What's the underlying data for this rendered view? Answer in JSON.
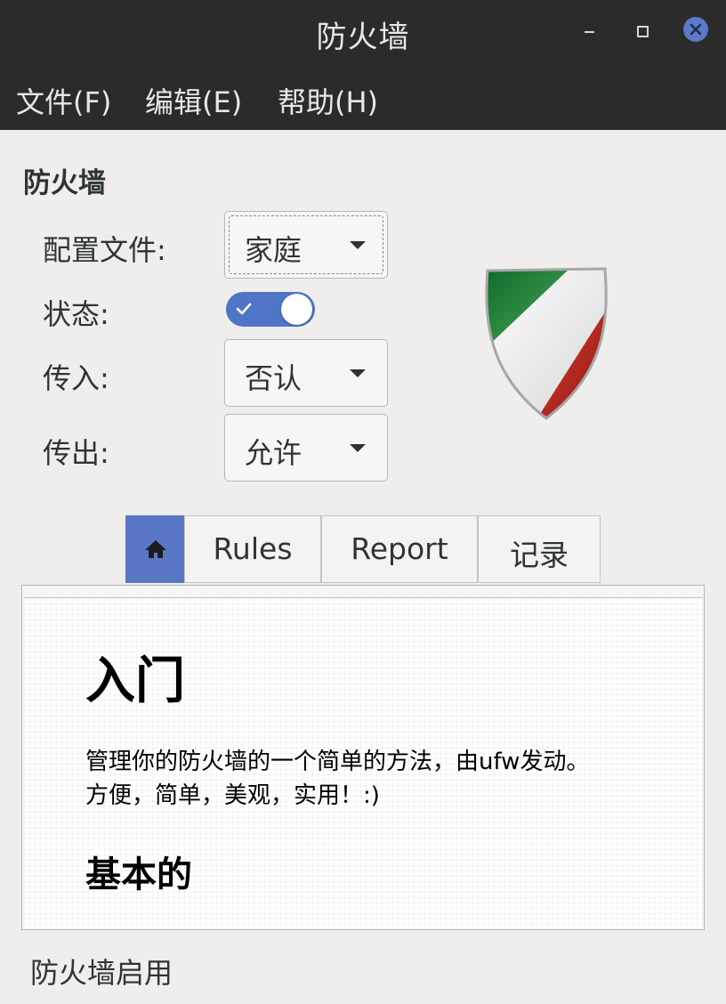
{
  "window": {
    "title": "防火墙"
  },
  "menu": {
    "file": "文件(F)",
    "edit": "编辑(E)",
    "help": "帮助(H)"
  },
  "firewall": {
    "section_title": "防火墙",
    "profile_label": "配置文件:",
    "profile_value": "家庭",
    "status_label": "状态:",
    "status_enabled": true,
    "incoming_label": "传入:",
    "incoming_value": "否认",
    "outgoing_label": "传出:",
    "outgoing_value": "允许"
  },
  "tabs": [
    {
      "label": "",
      "icon": "home-icon",
      "active": true
    },
    {
      "label": "Rules",
      "active": false
    },
    {
      "label": "Report",
      "active": false
    },
    {
      "label": "记录",
      "active": false
    }
  ],
  "content": {
    "heading": "入门",
    "line1": "管理你的防火墙的一个简单的方法，由ufw发动。",
    "line2": "方便，简单，美观，实用！:)",
    "subheading": "基本的"
  },
  "status_bar": {
    "text": "防火墙启用"
  },
  "colors": {
    "titlebar_bg": "#2b2b2b",
    "accent": "#5a77c6",
    "close_button": "#5b79c7",
    "window_bg": "#efeeed"
  }
}
